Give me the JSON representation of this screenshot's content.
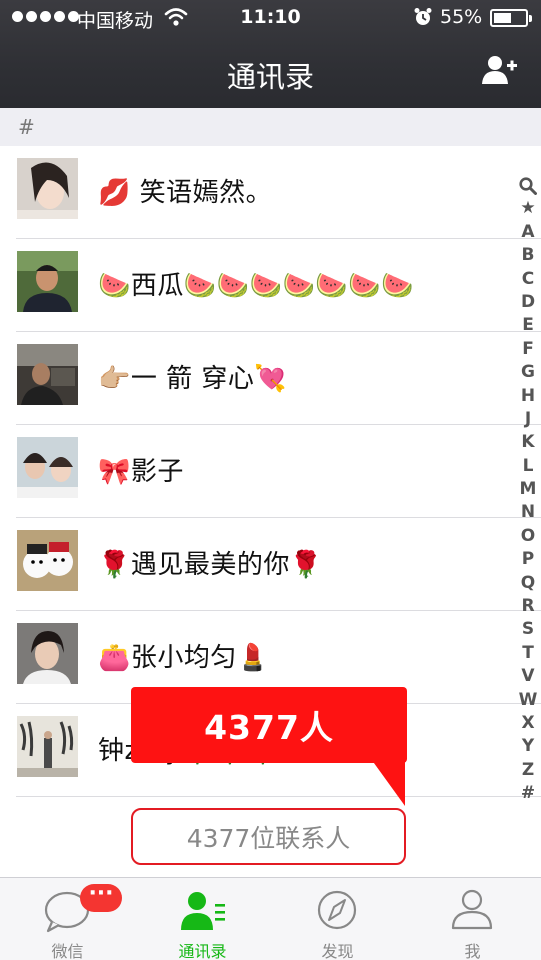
{
  "status_bar": {
    "carrier": "中国移动",
    "time": "11:10",
    "battery_percent": "55%",
    "battery_level": 0.55
  },
  "header": {
    "title": "通讯录",
    "add_icon": "add-friend-icon"
  },
  "section_letter": "#",
  "contacts": [
    {
      "name": "💋 笑语嫣然。"
    },
    {
      "name": "🍉西瓜🍉🍉🍉🍉🍉🍉🍉"
    },
    {
      "name": "👉🏼一 箭 穿心💘"
    },
    {
      "name": "🎀影子"
    },
    {
      "name": "🌹遇见最美的你🌹"
    },
    {
      "name": "👛张小均匀💄"
    },
    {
      "name": "钟z杨y🌹🌹🌹"
    }
  ],
  "index_letters": [
    "★",
    "A",
    "B",
    "C",
    "D",
    "E",
    "F",
    "G",
    "H",
    "J",
    "K",
    "L",
    "M",
    "N",
    "O",
    "P",
    "Q",
    "R",
    "S",
    "T",
    "V",
    "W",
    "X",
    "Y",
    "Z",
    "#"
  ],
  "callout_text": "4377人",
  "contact_count_text": "4377位联系人",
  "tabs": [
    {
      "label": "微信",
      "icon": "chat-bubble-icon",
      "badge": "···"
    },
    {
      "label": "通讯录",
      "icon": "contacts-icon"
    },
    {
      "label": "发现",
      "icon": "compass-icon"
    },
    {
      "label": "我",
      "icon": "person-icon"
    }
  ],
  "colors": {
    "accent_green": "#16b816",
    "callout_red": "#fe1212",
    "badge_red": "#f43531",
    "header_dark": "#2f3035"
  }
}
